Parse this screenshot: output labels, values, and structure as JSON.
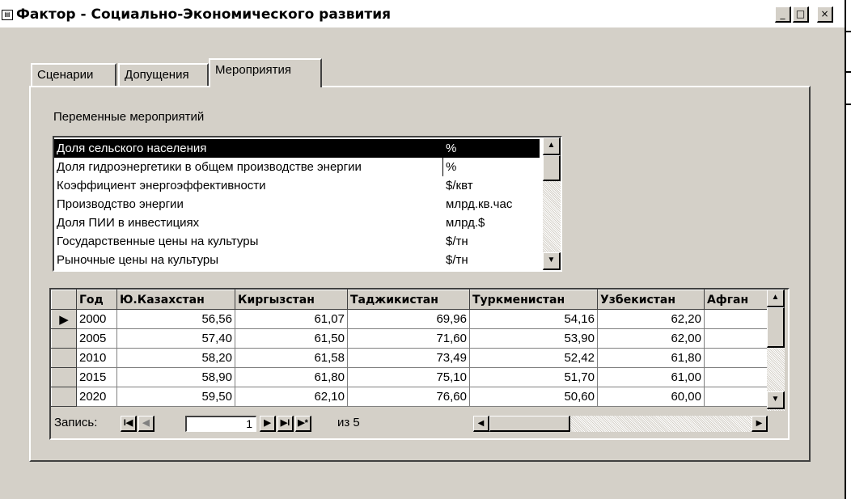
{
  "window": {
    "title": "Фактор - Социально-Экономического развития",
    "icon": "datasheet-icon",
    "controls": {
      "minimize": "_",
      "maximize": "□",
      "close": "×"
    }
  },
  "tabs": [
    {
      "label": "Сценарии",
      "active": false
    },
    {
      "label": "Допущения",
      "active": false
    },
    {
      "label": "Мероприятия",
      "active": true
    }
  ],
  "variables": {
    "label": "Переменные мероприятий",
    "items": [
      {
        "name": "Доля сельского населения",
        "unit": "%",
        "selected": true
      },
      {
        "name": "Доля гидроэнергетики в общем производстве энергии",
        "unit": "%",
        "selected": false
      },
      {
        "name": "Коэффициент энергоэффективности",
        "unit": "$/квт",
        "selected": false
      },
      {
        "name": "Производство энергии",
        "unit": "млрд.кв.час",
        "selected": false
      },
      {
        "name": "Доля ПИИ в инвестициях",
        "unit": "млрд.$",
        "selected": false
      },
      {
        "name": "Государственные цены на культуры",
        "unit": "$/тн",
        "selected": false
      },
      {
        "name": "Рыночные цены на культуры",
        "unit": "$/тн",
        "selected": false
      }
    ]
  },
  "table": {
    "columns": [
      "Год",
      "Ю.Казахстан",
      "Киргызстан",
      "Таджикистан",
      "Туркменистан",
      "Узбекистан",
      "Афган"
    ],
    "rows": [
      {
        "values": [
          "2000",
          "56,56",
          "61,07",
          "69,96",
          "54,16",
          "62,20",
          ""
        ],
        "current": true
      },
      {
        "values": [
          "2005",
          "57,40",
          "61,50",
          "71,60",
          "53,90",
          "62,00",
          ""
        ],
        "current": false
      },
      {
        "values": [
          "2010",
          "58,20",
          "61,58",
          "73,49",
          "52,42",
          "61,80",
          ""
        ],
        "current": false
      },
      {
        "values": [
          "2015",
          "58,90",
          "61,80",
          "75,10",
          "51,70",
          "61,00",
          ""
        ],
        "current": false
      },
      {
        "values": [
          "2020",
          "59,50",
          "62,10",
          "76,60",
          "50,60",
          "60,00",
          ""
        ],
        "current": false
      }
    ],
    "navigation": {
      "label": "Запись:",
      "current": "1",
      "of_label": "из 5",
      "buttons": {
        "first": "I◀",
        "prev": "◀",
        "next": "▶",
        "last": "▶I",
        "new": "▶*"
      }
    }
  }
}
